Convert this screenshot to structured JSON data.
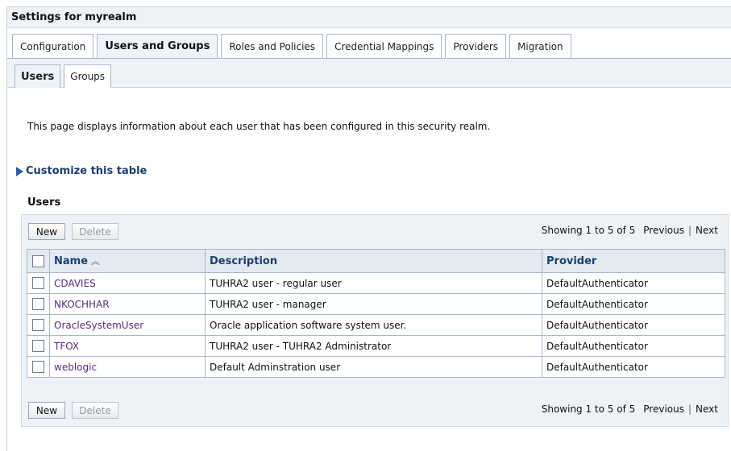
{
  "header": {
    "title": "Settings for myrealm"
  },
  "tabs": [
    {
      "label": "Configuration",
      "active": false
    },
    {
      "label": "Users and Groups",
      "active": true
    },
    {
      "label": "Roles and Policies",
      "active": false
    },
    {
      "label": "Credential Mappings",
      "active": false
    },
    {
      "label": "Providers",
      "active": false
    },
    {
      "label": "Migration",
      "active": false
    }
  ],
  "subtabs": [
    {
      "label": "Users",
      "active": true
    },
    {
      "label": "Groups",
      "active": false
    }
  ],
  "page": {
    "description": "This page displays information about each user that has been configured in this security realm.",
    "customize_label": "Customize this table",
    "section_title": "Users"
  },
  "toolbar": {
    "new_label": "New",
    "delete_label": "Delete",
    "showing": "Showing 1 to 5 of 5",
    "previous": "Previous",
    "next": "Next"
  },
  "table": {
    "columns": [
      "Name",
      "Description",
      "Provider"
    ],
    "sort_icon": "double-chevron-up-icon",
    "rows": [
      {
        "name": "CDAVIES",
        "description": "TUHRA2 user - regular user",
        "provider": "DefaultAuthenticator"
      },
      {
        "name": "NKOCHHAR",
        "description": "TUHRA2 user - manager",
        "provider": "DefaultAuthenticator"
      },
      {
        "name": "OracleSystemUser",
        "description": "Oracle application software system user.",
        "provider": "DefaultAuthenticator"
      },
      {
        "name": "TFOX",
        "description": "TUHRA2 user - TUHRA2 Administrator",
        "provider": "DefaultAuthenticator"
      },
      {
        "name": "weblogic",
        "description": "Default Adminstration user",
        "provider": "DefaultAuthenticator"
      }
    ]
  },
  "colors": {
    "link": "#5a2a82",
    "header_text": "#1d3f6e",
    "border": "#a9b8c9"
  }
}
